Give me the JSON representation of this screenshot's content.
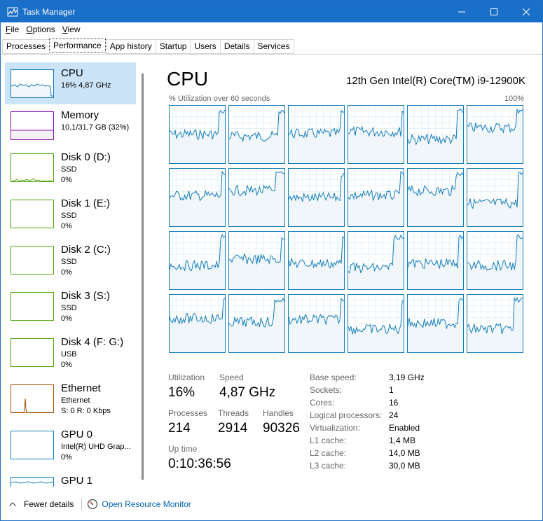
{
  "window": {
    "title": "Task Manager"
  },
  "menu": [
    "File",
    "Options",
    "View"
  ],
  "tabs": [
    "Processes",
    "Performance",
    "App history",
    "Startup",
    "Users",
    "Details",
    "Services"
  ],
  "sidebar": [
    {
      "name": "CPU",
      "sub1": "16% 4,87 GHz",
      "sub2": "",
      "color": "#117dbb"
    },
    {
      "name": "Memory",
      "sub1": "10,1/31,7 GB (32%)",
      "sub2": "",
      "color": "#8b12ae"
    },
    {
      "name": "Disk 0 (D:)",
      "sub1": "SSD",
      "sub2": "0%",
      "color": "#4da60c"
    },
    {
      "name": "Disk 1 (E:)",
      "sub1": "SSD",
      "sub2": "0%",
      "color": "#4da60c"
    },
    {
      "name": "Disk 2 (C:)",
      "sub1": "SSD",
      "sub2": "0%",
      "color": "#4da60c"
    },
    {
      "name": "Disk 3 (S:)",
      "sub1": "SSD",
      "sub2": "0%",
      "color": "#4da60c"
    },
    {
      "name": "Disk 4 (F: G:)",
      "sub1": "USB",
      "sub2": "0%",
      "color": "#4da60c"
    },
    {
      "name": "Ethernet",
      "sub1": "Ethernet",
      "sub2": "S: 0 R: 0 Kbps",
      "color": "#a74f01"
    },
    {
      "name": "GPU 0",
      "sub1": "Intel(R) UHD Grap...",
      "sub2": "0%",
      "color": "#117dbb"
    },
    {
      "name": "GPU 1",
      "sub1": "",
      "sub2": "",
      "color": "#117dbb"
    }
  ],
  "main": {
    "title": "CPU",
    "model": "12th Gen Intel(R) Core(TM) i9-12900K",
    "graph_label": "% Utilization over 60 seconds",
    "graph_max": "100%",
    "graph_color": "#117dbb"
  },
  "stats": {
    "utilization_label": "Utilization",
    "utilization": "16%",
    "speed_label": "Speed",
    "speed": "4,87 GHz",
    "processes_label": "Processes",
    "processes": "214",
    "threads_label": "Threads",
    "threads": "2914",
    "handles_label": "Handles",
    "handles": "90326",
    "uptime_label": "Up time",
    "uptime": "0:10:36:56"
  },
  "specs": [
    {
      "k": "Base speed:",
      "v": "3,19 GHz"
    },
    {
      "k": "Sockets:",
      "v": "1"
    },
    {
      "k": "Cores:",
      "v": "16"
    },
    {
      "k": "Logical processors:",
      "v": "24"
    },
    {
      "k": "Virtualization:",
      "v": "Enabled"
    },
    {
      "k": "L1 cache:",
      "v": "1,4 MB"
    },
    {
      "k": "L2 cache:",
      "v": "14,0 MB"
    },
    {
      "k": "L3 cache:",
      "v": "30,0 MB"
    }
  ],
  "footer": {
    "fewer": "Fewer details",
    "link": "Open Resource Monitor"
  }
}
